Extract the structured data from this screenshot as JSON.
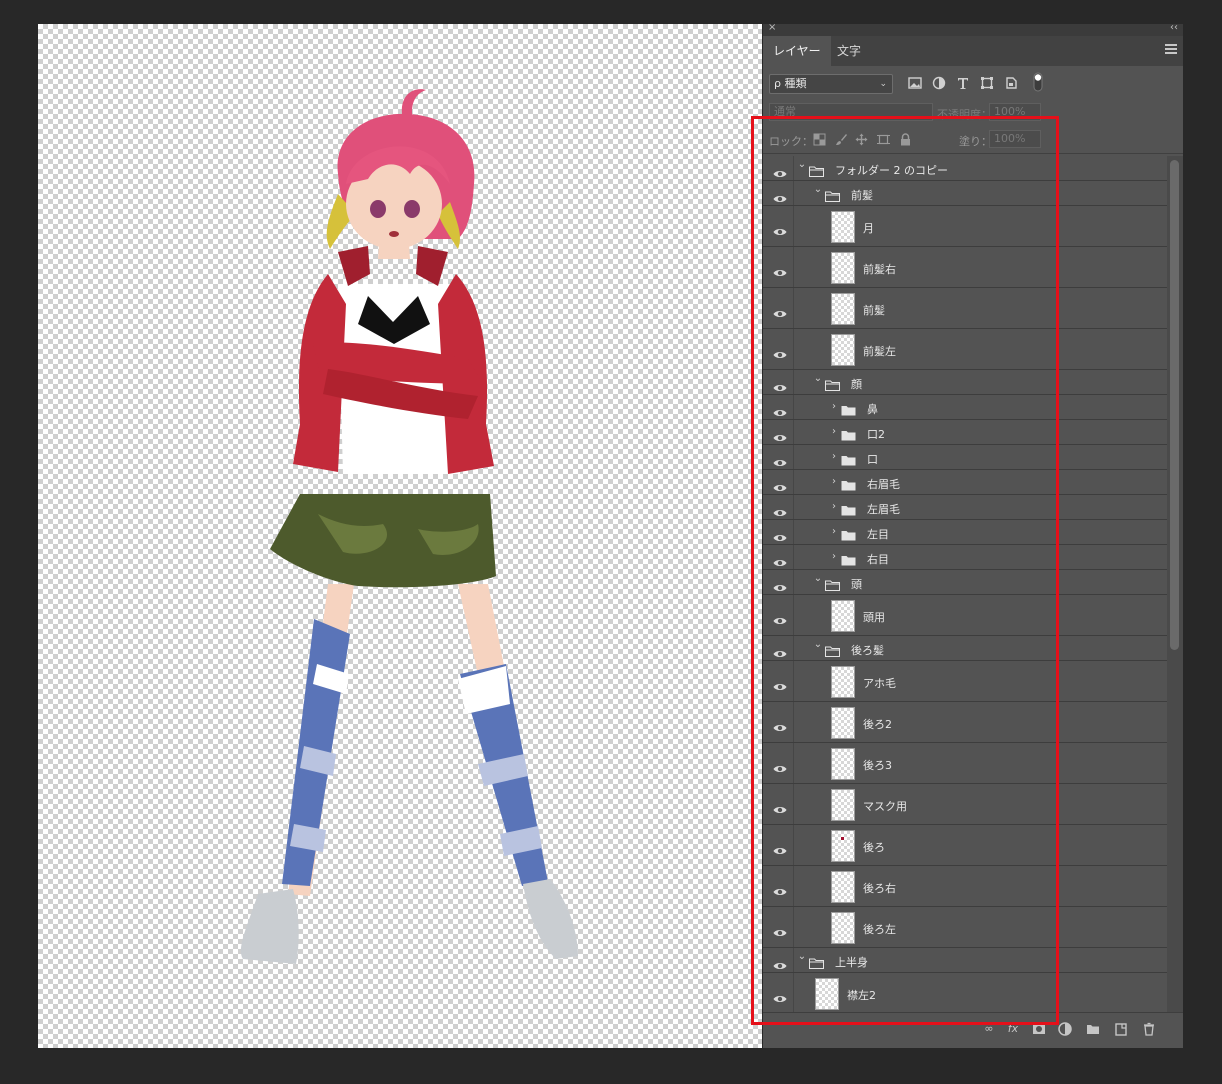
{
  "panel": {
    "tabs": [
      {
        "label": "レイヤー",
        "active": true
      },
      {
        "label": "文字",
        "active": false
      }
    ],
    "filter": {
      "label": "ρ 種類"
    },
    "blend_mode": "通常",
    "opacity_label": "不透明度：",
    "opacity_value": "100%",
    "lock_label": "ロック：",
    "fill_label": "塗り：",
    "fill_value": "100%"
  },
  "layers": [
    {
      "name": "フォルダー 2 のコピー",
      "kind": "group",
      "expanded": true,
      "depth": 0
    },
    {
      "name": "前髪",
      "kind": "group",
      "expanded": true,
      "depth": 1
    },
    {
      "name": "月",
      "kind": "layer",
      "depth": 2
    },
    {
      "name": "前髪右",
      "kind": "layer",
      "depth": 2
    },
    {
      "name": "前髪",
      "kind": "layer",
      "depth": 2
    },
    {
      "name": "前髪左",
      "kind": "layer",
      "depth": 2
    },
    {
      "name": "顔",
      "kind": "group",
      "expanded": true,
      "depth": 1
    },
    {
      "name": "鼻",
      "kind": "group",
      "expanded": false,
      "depth": 2
    },
    {
      "name": "口2",
      "kind": "group",
      "expanded": false,
      "depth": 2
    },
    {
      "name": "口",
      "kind": "group",
      "expanded": false,
      "depth": 2
    },
    {
      "name": "右眉毛",
      "kind": "group",
      "expanded": false,
      "depth": 2
    },
    {
      "name": "左眉毛",
      "kind": "group",
      "expanded": false,
      "depth": 2
    },
    {
      "name": "左目",
      "kind": "group",
      "expanded": false,
      "depth": 2
    },
    {
      "name": "右目",
      "kind": "group",
      "expanded": false,
      "depth": 2
    },
    {
      "name": "頭",
      "kind": "group",
      "expanded": true,
      "depth": 1
    },
    {
      "name": "頭用",
      "kind": "layer",
      "depth": 2
    },
    {
      "name": "後ろ髪",
      "kind": "group",
      "expanded": true,
      "depth": 1
    },
    {
      "name": "アホ毛",
      "kind": "layer",
      "depth": 2
    },
    {
      "name": "後ろ2",
      "kind": "layer",
      "depth": 2
    },
    {
      "name": "後ろ3",
      "kind": "layer",
      "depth": 2
    },
    {
      "name": "マスク用",
      "kind": "layer",
      "depth": 2
    },
    {
      "name": "後ろ",
      "kind": "layer",
      "depth": 2,
      "dot": true
    },
    {
      "name": "後ろ右",
      "kind": "layer",
      "depth": 2
    },
    {
      "name": "後ろ左",
      "kind": "layer",
      "depth": 2
    },
    {
      "name": "上半身",
      "kind": "group",
      "expanded": true,
      "depth": 0
    },
    {
      "name": "襟左2",
      "kind": "layer",
      "depth": 1
    }
  ],
  "colors": {
    "panel_bg": "#535353",
    "highlight": "#e5101a",
    "jacket": "#c32a3a",
    "hair": "#e5557e",
    "skirt": "#4d5a2c",
    "sock_blue": "#5a74b8"
  }
}
